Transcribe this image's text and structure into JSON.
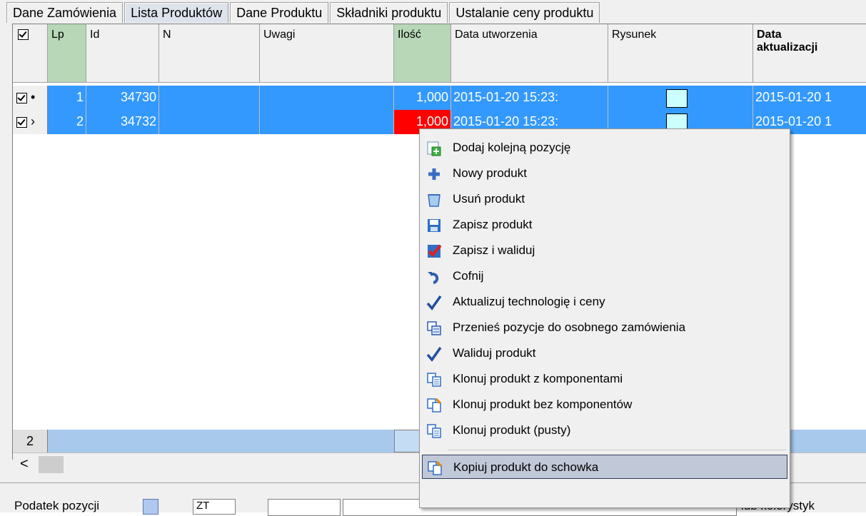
{
  "tabs": [
    {
      "label": "Dane Zamówienia",
      "active": false
    },
    {
      "label": "Lista Produktów",
      "active": true
    },
    {
      "label": "Dane Produktu",
      "active": false
    },
    {
      "label": "Składniki produktu",
      "active": false
    },
    {
      "label": "Ustalanie ceny produktu",
      "active": false
    }
  ],
  "columns": {
    "lp": "Lp",
    "id": "Id",
    "n": "N",
    "uwagi": "Uwagi",
    "ilosc": "Ilość",
    "data_utworzenia": "Data utworzenia",
    "rysunek": "Rysunek",
    "data_aktualizacji_1": "Data",
    "data_aktualizacji_2": "aktualizacji"
  },
  "rows": [
    {
      "indicator": "•",
      "lp": "1",
      "id": "34730",
      "n": "",
      "uwagi": "",
      "ilosc": "1,000",
      "data_utworzenia": "2015-01-20 15:23:",
      "data_aktualizacji": "2015-01-20 1"
    },
    {
      "indicator": "›",
      "lp": "2",
      "id": "34732",
      "n": "",
      "uwagi": "",
      "ilosc": "1,000",
      "data_utworzenia": "2015-01-20 15:23:",
      "data_aktualizacji": "2015-01-20 1"
    }
  ],
  "footer": {
    "count": "2"
  },
  "scroll": {
    "left_arrow": "<"
  },
  "bottom": {
    "label_left": "Podatek pozycji",
    "input1": "ZT",
    "label_right": "lub kolorystyk"
  },
  "context_menu": {
    "items": [
      {
        "label": "Dodaj kolejną pozycję",
        "icon": "add-position-icon"
      },
      {
        "label": "Nowy produkt",
        "icon": "plus-icon"
      },
      {
        "label": "Usuń produkt",
        "icon": "trash-icon"
      },
      {
        "label": "Zapisz produkt",
        "icon": "save-icon"
      },
      {
        "label": "Zapisz i waliduj",
        "icon": "save-validate-icon"
      },
      {
        "label": "Cofnij",
        "icon": "undo-icon"
      },
      {
        "label": "Aktualizuj technologię i ceny",
        "icon": "check-icon"
      },
      {
        "label": "Przenieś pozycje do osobnego zamówienia",
        "icon": "move-icon"
      },
      {
        "label": "Waliduj produkt",
        "icon": "check-icon"
      },
      {
        "label": "Klonuj produkt z komponentami",
        "icon": "clone-icon"
      },
      {
        "label": "Klonuj produkt bez komponentów",
        "icon": "clone-partial-icon"
      },
      {
        "label": "Klonuj produkt (pusty)",
        "icon": "clone-icon"
      },
      {
        "label": "Kopiuj produkt do schowka",
        "icon": "copy-clipboard-icon",
        "selected": true
      }
    ]
  },
  "colors": {
    "selection": "#3399ff",
    "error_cell": "#ff0000",
    "menu_highlight": "#c1c8d8",
    "header_green": "#b7d7b7"
  }
}
